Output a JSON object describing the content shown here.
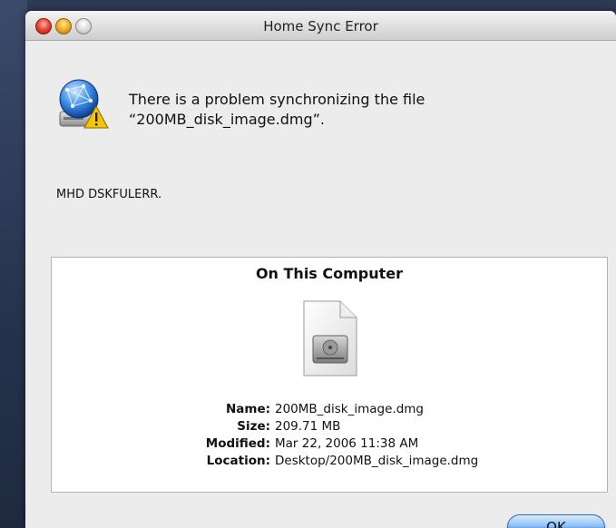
{
  "window": {
    "title": "Home Sync Error"
  },
  "alert": {
    "icon": "network-home-warning-icon",
    "message_line1": "There is a problem synchronizing the file",
    "message_line2": "“200MB_disk_image.dmg”.",
    "error_code": "MHD DSKFULERR."
  },
  "panel": {
    "title": "On This Computer",
    "file_icon": "disk-image-file-icon",
    "fields": [
      {
        "label": "Name:",
        "value": "200MB_disk_image.dmg"
      },
      {
        "label": "Size:",
        "value": "209.71 MB"
      },
      {
        "label": "Modified:",
        "value": "Mar 22, 2006 11:38 AM"
      },
      {
        "label": "Location:",
        "value": "Desktop/200MB_disk_image.dmg"
      }
    ]
  },
  "buttons": {
    "ok_label": "OK"
  },
  "colors": {
    "ok_button_accent": "#5d9ee8",
    "close_button": "#e84a3a",
    "minimize_button": "#f2b126",
    "warning_yellow": "#f7c500"
  }
}
